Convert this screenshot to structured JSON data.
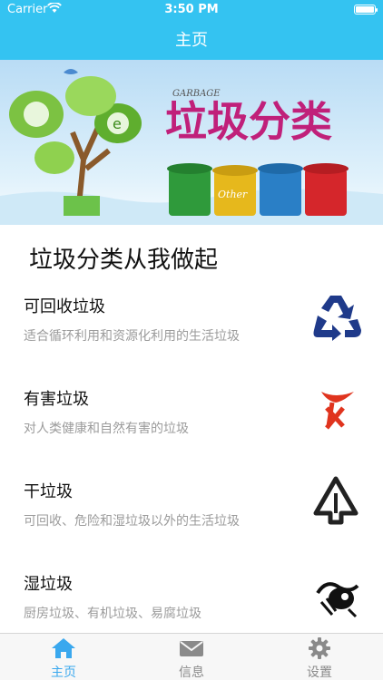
{
  "status": {
    "carrier": "Carrier",
    "time": "3:50 PM"
  },
  "nav": {
    "title": "主页"
  },
  "banner": {
    "small_text": "GARBAGE",
    "title": "垃圾分类",
    "bin_label": "Other"
  },
  "section_title": "垃圾分类从我做起",
  "items": [
    {
      "name": "可回收垃圾",
      "desc": "适合循环利用和资源化利用的生活垃圾",
      "icon": "recycle-icon"
    },
    {
      "name": "有害垃圾",
      "desc": "对人类健康和自然有害的垃圾",
      "icon": "hazardous-icon"
    },
    {
      "name": "干垃圾",
      "desc": "可回收、危险和湿垃圾以外的生活垃圾",
      "icon": "dry-waste-icon"
    },
    {
      "name": "湿垃圾",
      "desc": "厨房垃圾、有机垃圾、易腐垃圾",
      "icon": "wet-waste-icon"
    }
  ],
  "tabs": [
    {
      "label": "主页",
      "icon": "home-icon",
      "active": true
    },
    {
      "label": "信息",
      "icon": "mail-icon",
      "active": false
    },
    {
      "label": "设置",
      "icon": "gear-icon",
      "active": false
    }
  ],
  "colors": {
    "nav": "#34c3f1",
    "active_tab": "#3aa8ee",
    "recycle": "#1f3a8a",
    "hazard": "#e0341e"
  }
}
